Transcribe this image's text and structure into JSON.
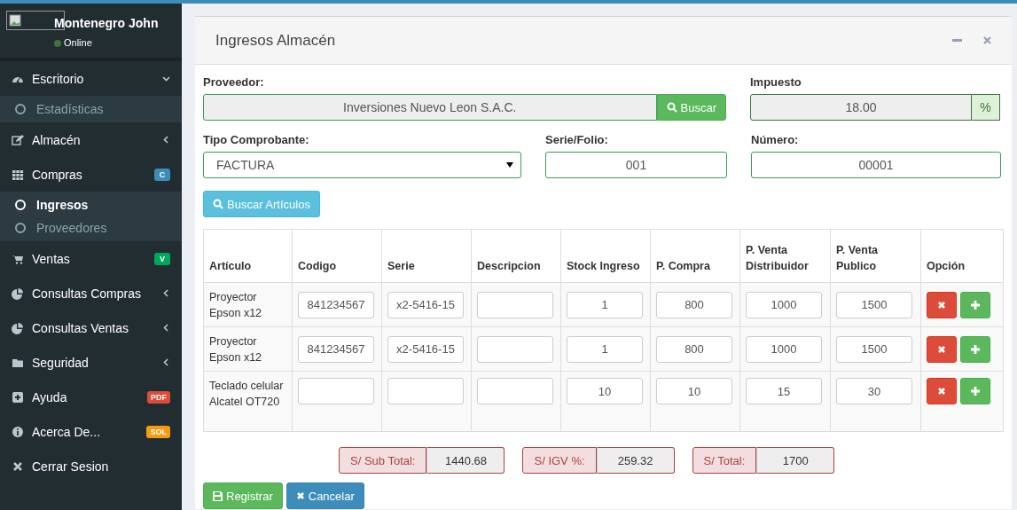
{
  "user": {
    "name": "Montenegro John",
    "status": "Online"
  },
  "sidebar": {
    "items": [
      {
        "label": "Escritorio",
        "kind": "tree",
        "expanded": true,
        "children": [
          {
            "label": "Estadísticas",
            "selected": false
          }
        ]
      },
      {
        "label": "Almacén",
        "kind": "tree",
        "expanded": false
      },
      {
        "label": "Compras",
        "kind": "badge",
        "badge": "C",
        "color": "#3c8dbc",
        "children": [
          {
            "label": "Ingresos",
            "selected": true
          },
          {
            "label": "Proveedores",
            "selected": false
          }
        ]
      },
      {
        "label": "Ventas",
        "kind": "badge",
        "badge": "V",
        "color": "#00a65a"
      },
      {
        "label": "Consultas Compras",
        "kind": "tree",
        "expanded": false
      },
      {
        "label": "Consultas Ventas",
        "kind": "tree",
        "expanded": false
      },
      {
        "label": "Seguridad",
        "kind": "tree",
        "expanded": false
      },
      {
        "label": "Ayuda",
        "kind": "badge",
        "badge": "PDF",
        "color": "#dd4b39"
      },
      {
        "label": "Acerca De...",
        "kind": "badge",
        "badge": "SOL",
        "color": "#f39c12"
      },
      {
        "label": "Cerrar Sesion",
        "kind": "plain"
      }
    ]
  },
  "panel": {
    "title": "Ingresos Almacén",
    "proveedor": {
      "label": "Proveedor:",
      "value": "Inversiones Nuevo Leon S.A.C.",
      "button": "Buscar"
    },
    "impuesto": {
      "label": "Impuesto",
      "value": "18.00",
      "addon": "%"
    },
    "tipo": {
      "label": "Tipo Comprobante:",
      "value": "FACTURA"
    },
    "serie": {
      "label": "Serie/Folio:",
      "value": "001"
    },
    "numero": {
      "label": "Número:",
      "value": "00001"
    },
    "buscar_articulos": "Buscar Artículos",
    "table": {
      "columns": [
        "Artículo",
        "Codigo",
        "Serie",
        "Descripcion",
        "Stock Ingreso",
        "P. Compra",
        "P. Venta Distribuidor",
        "P. Venta Publico",
        "Opción"
      ],
      "rows": [
        {
          "articulo": "Proyector Epson x12",
          "codigo": "841234567",
          "serie": "x2-5416-15",
          "descripcion": "",
          "stock": "1",
          "compra": "800",
          "distribuidor": "1000",
          "publico": "1500"
        },
        {
          "articulo": "Proyector Epson x12",
          "codigo": "841234567",
          "serie": "x2-5416-15",
          "descripcion": "",
          "stock": "1",
          "compra": "800",
          "distribuidor": "1000",
          "publico": "1500"
        },
        {
          "articulo": "Teclado celular Alcatel OT720",
          "codigo": "",
          "serie": "",
          "descripcion": "",
          "stock": "10",
          "compra": "10",
          "distribuidor": "15",
          "publico": "30"
        }
      ]
    },
    "totals": [
      {
        "label": "S/ Sub Total:",
        "value": "1440.68"
      },
      {
        "label": "S/ IGV %:",
        "value": "259.32"
      },
      {
        "label": "S/ Total:",
        "value": "1700"
      }
    ],
    "buttons": [
      {
        "label": "Registrar",
        "kind": "save"
      },
      {
        "label": "Cancelar",
        "kind": "cancel"
      }
    ]
  }
}
